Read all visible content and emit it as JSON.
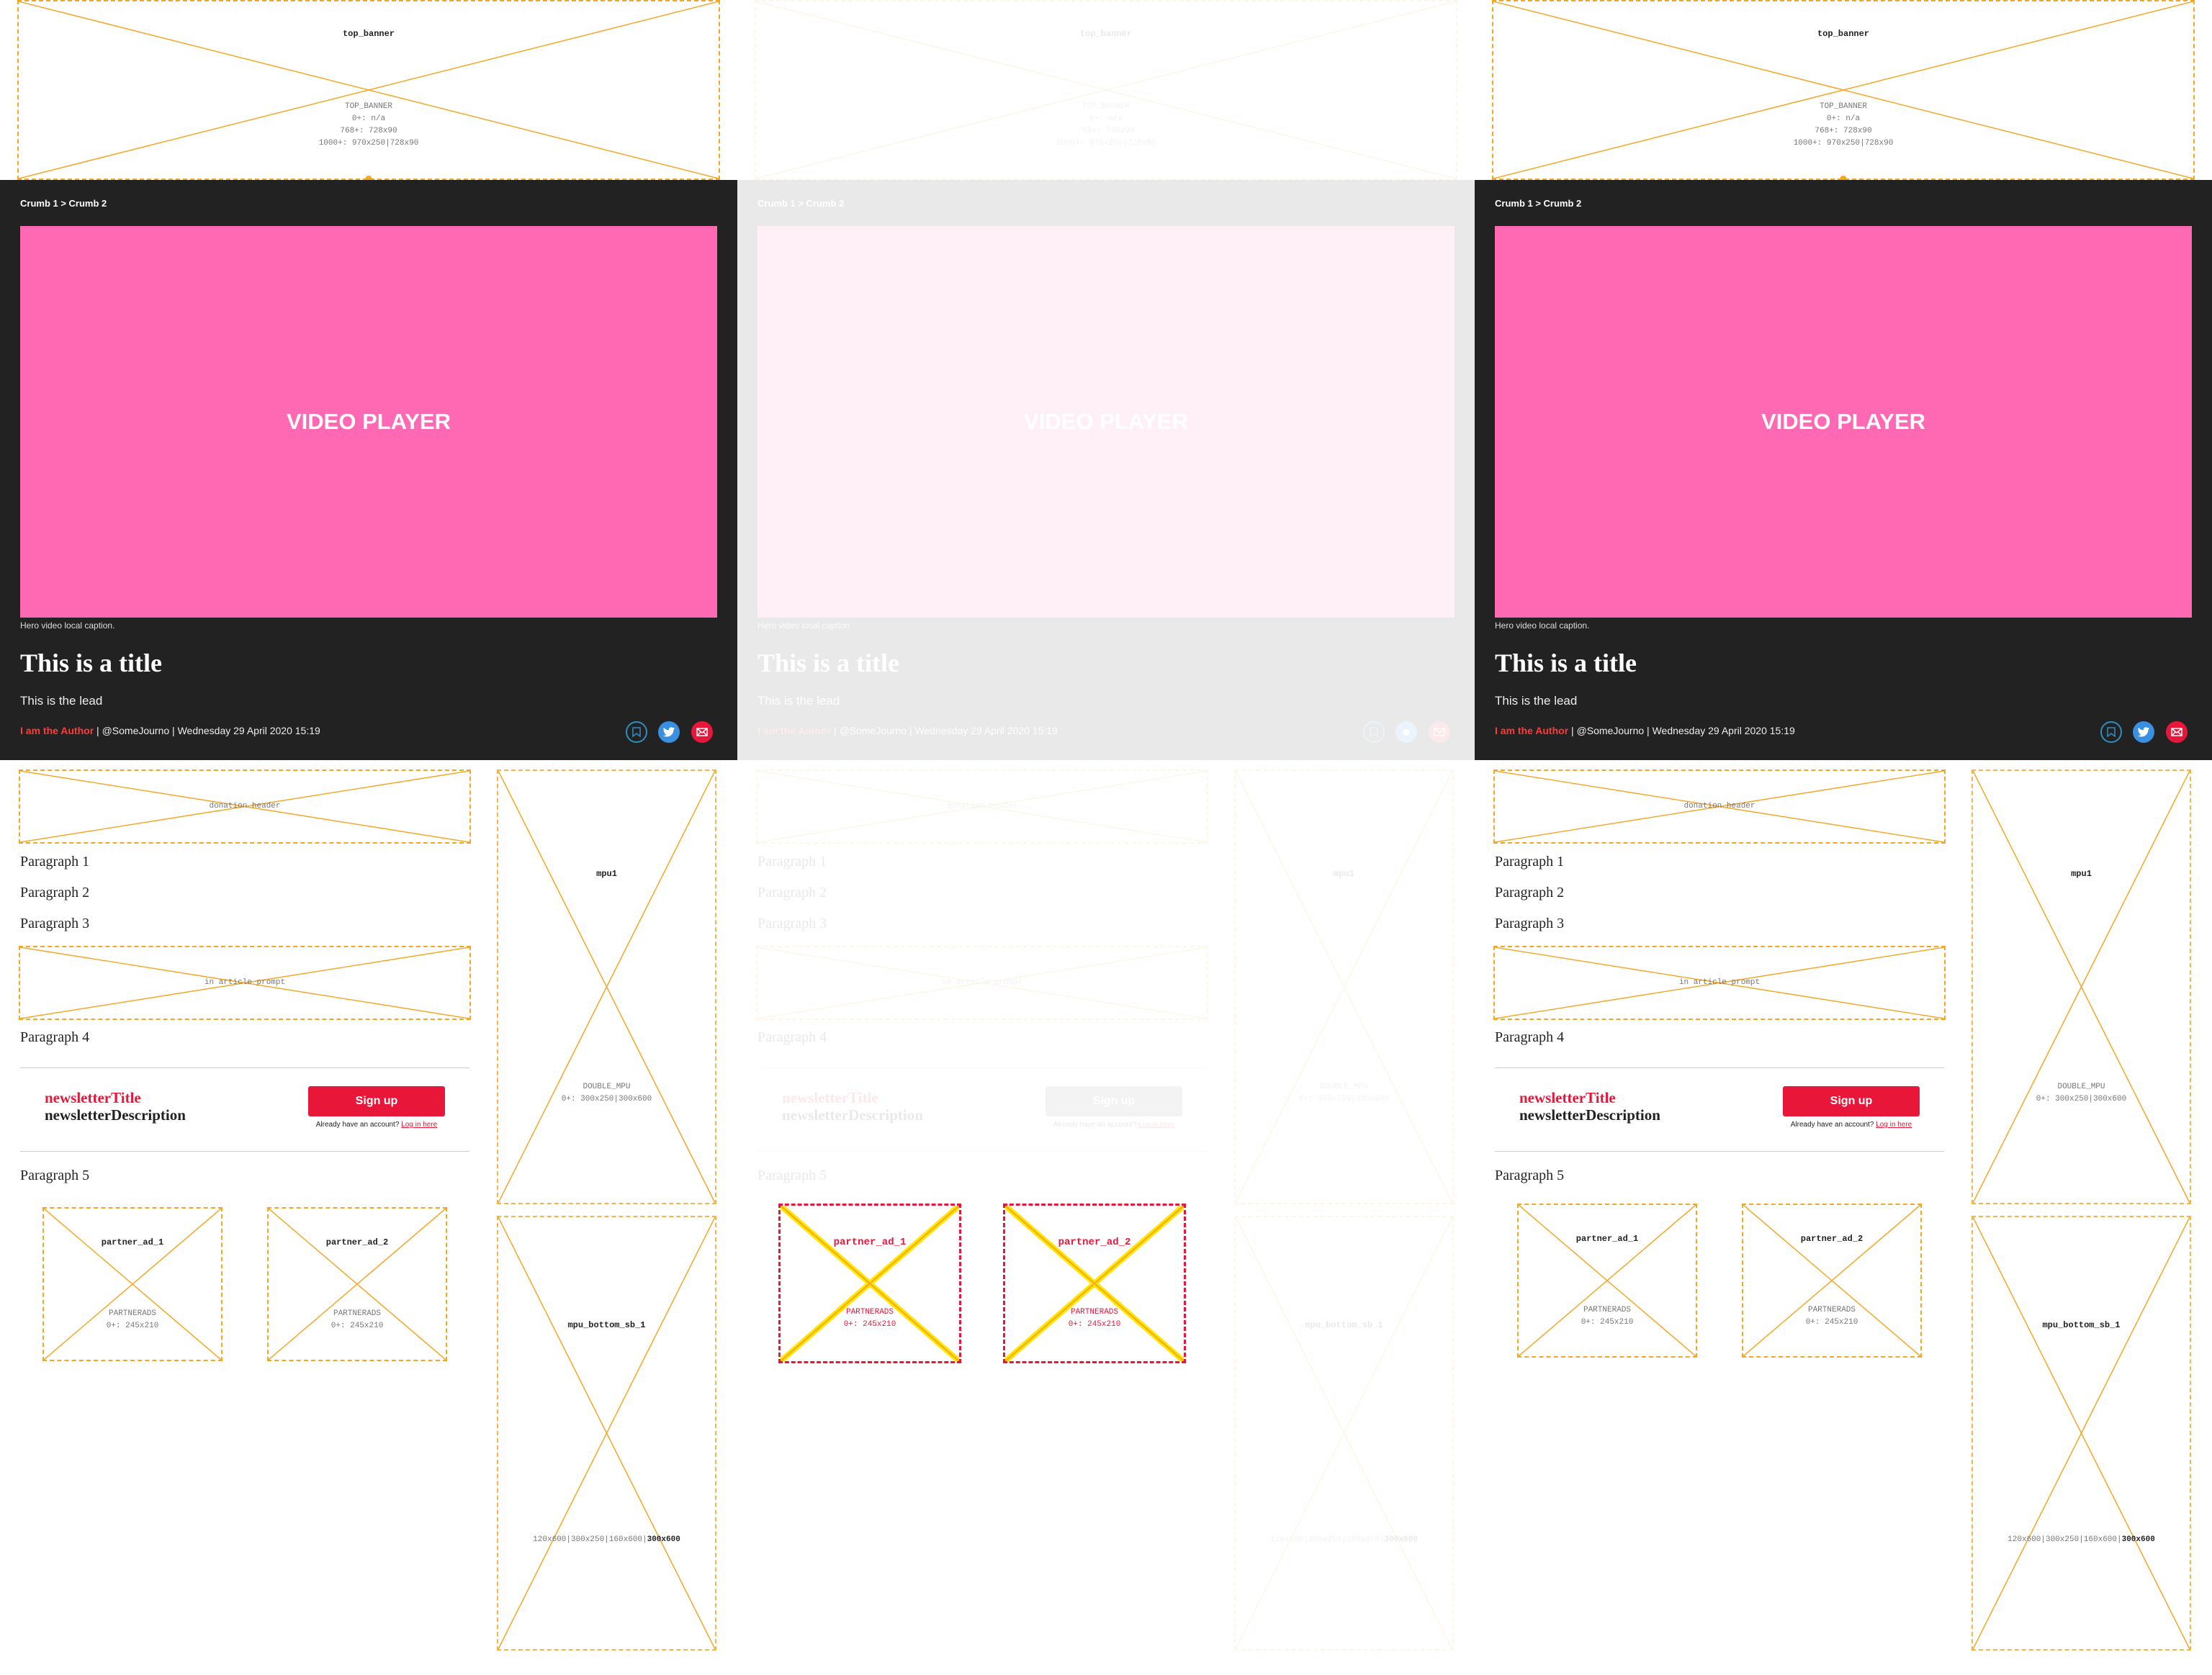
{
  "top_banner": {
    "name": "top_banner",
    "info": "TOP_BANNER\n0+: n/a\n768+: 728x90\n1000+: 970x250|728x90"
  },
  "breadcrumb": "Crumb 1 > Crumb 2",
  "video_label": "VIDEO PLAYER",
  "caption": "Hero video local caption.",
  "title": "This is a title",
  "lead": "This is the lead",
  "byline": {
    "author": "I am the Author",
    "rest": " | @SomeJourno | Wednesday 29 April 2020 15:19"
  },
  "donation_header": "donation header",
  "paragraphs": {
    "p1": "Paragraph 1",
    "p2": "Paragraph 2",
    "p3": "Paragraph 3",
    "p4": "Paragraph 4",
    "p5": "Paragraph 5"
  },
  "in_article_prompt": "in article prompt",
  "newsletter": {
    "title": "newsletterTitle",
    "description": "newsletterDescription",
    "signup_label": "Sign up",
    "already_text": "Already have an account?",
    "login_link": "Log in here"
  },
  "partner_ads": [
    {
      "name": "partner_ad_1",
      "info": "PARTNERADS\n0+: 245x210"
    },
    {
      "name": "partner_ad_2",
      "info": "PARTNERADS\n0+: 245x210"
    }
  ],
  "mpu1": {
    "name": "mpu1",
    "info": "DOUBLE_MPU\n0+: 300x250|300x600"
  },
  "mpu_bottom": {
    "name": "mpu_bottom_sb_1",
    "sizes": "120x600|300x250|160x600|",
    "sizes_bold": "300x600"
  },
  "colors": {
    "accent": "#e8173a",
    "hero_bg": "#222222",
    "video_bg": "#ff69b4",
    "slot_border": "#f5a623"
  },
  "icons": [
    "bookmark-icon",
    "twitter-icon",
    "email-icon"
  ]
}
